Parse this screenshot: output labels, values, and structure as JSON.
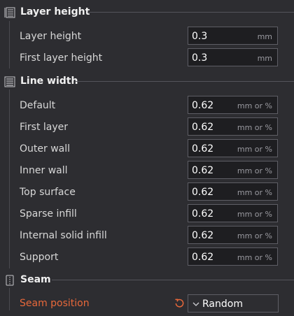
{
  "sections": {
    "layer_height": {
      "title": "Layer height",
      "icon": "layer-height-icon",
      "rows": [
        {
          "label": "Layer height",
          "value": "0.3",
          "unit": "mm"
        },
        {
          "label": "First layer height",
          "value": "0.3",
          "unit": "mm"
        }
      ]
    },
    "line_width": {
      "title": "Line width",
      "icon": "line-width-icon",
      "rows": [
        {
          "label": "Default",
          "value": "0.62",
          "unit": "mm or %"
        },
        {
          "label": "First layer",
          "value": "0.62",
          "unit": "mm or %"
        },
        {
          "label": "Outer wall",
          "value": "0.62",
          "unit": "mm or %"
        },
        {
          "label": "Inner wall",
          "value": "0.62",
          "unit": "mm or %"
        },
        {
          "label": "Top surface",
          "value": "0.62",
          "unit": "mm or %"
        },
        {
          "label": "Sparse infill",
          "value": "0.62",
          "unit": "mm or %"
        },
        {
          "label": "Internal solid infill",
          "value": "0.62",
          "unit": "mm or %"
        },
        {
          "label": "Support",
          "value": "0.62",
          "unit": "mm or %"
        }
      ]
    },
    "seam": {
      "title": "Seam",
      "icon": "seam-icon",
      "rows": [
        {
          "label": "Seam position",
          "value": "Random",
          "modified": true
        }
      ]
    }
  },
  "colors": {
    "background": "#2d2d31",
    "field_background": "#1e1e21",
    "field_border": "#5e5e65",
    "modified_label": "#e8683a",
    "text": "#d8d8d8"
  }
}
